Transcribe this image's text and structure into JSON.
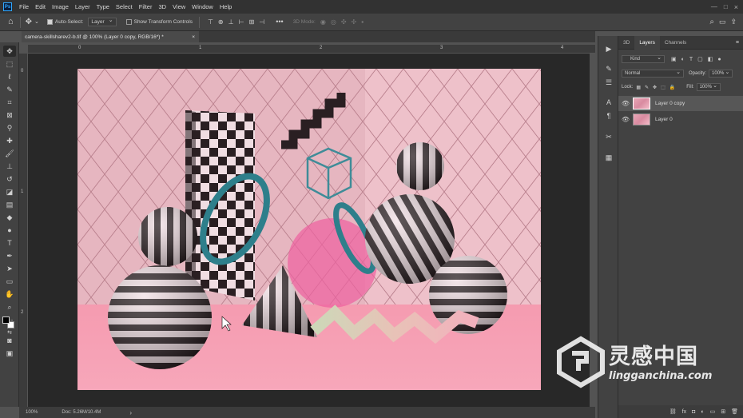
{
  "menubar": {
    "items": [
      "File",
      "Edit",
      "Image",
      "Layer",
      "Type",
      "Select",
      "Filter",
      "3D",
      "View",
      "Window",
      "Help"
    ]
  },
  "options": {
    "auto_select_label": "Auto-Select:",
    "auto_select_value": "Layer",
    "transform_label": "Show Transform Controls",
    "mode_3d_label": "3D Mode:"
  },
  "document": {
    "tab_label": "camera-skillsharev2-b.tif @ 100% (Layer 0 copy, RGB/16*) *",
    "close_glyph": "×",
    "zoom": "100%",
    "doc_size": "Doc: 5.26M/10.4M",
    "ruler_top_marks": [
      "0",
      "1",
      "2",
      "3",
      "4"
    ],
    "ruler_left_marks": [
      "0",
      "1",
      "2"
    ]
  },
  "panels": {
    "tabs": [
      "3D",
      "Layers",
      "Channels"
    ],
    "active_tab": "Layers",
    "filter_kind": "Kind",
    "blend_mode": "Normal",
    "opacity_label": "Opacity:",
    "opacity_value": "100%",
    "lock_label": "Lock:",
    "fill_label": "Fill:",
    "fill_value": "100%",
    "layers": [
      {
        "name": "Layer 0 copy",
        "selected": true
      },
      {
        "name": "Layer 0",
        "selected": false
      }
    ]
  },
  "watermark": {
    "cn_text": "灵感中国",
    "url_text": "lingganchina.com"
  },
  "colors": {
    "accent": "#31a8ff",
    "canvas_bg": "#f3a3b6",
    "wall": "#e7b9c3"
  }
}
